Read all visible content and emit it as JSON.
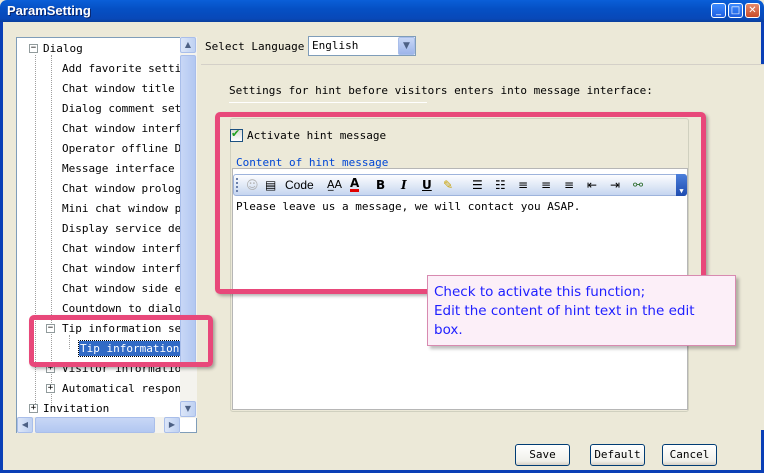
{
  "window": {
    "title": "ParamSetting",
    "controls": {
      "minimize": "_",
      "maximize": "□",
      "close": "✕"
    }
  },
  "tree": {
    "root_dialog": "Dialog",
    "items": [
      "Add favorite setting",
      "Chat window title se",
      "Dialog comment setti",
      "Chat window interfac",
      "Operator offline Dis",
      "Message interface se",
      "Chat window prologue",
      "Mini chat window pro",
      "Display service depa",
      "Chat window interfac",
      "Chat window interfac",
      "Chat window side edg",
      "Countdown to dialog"
    ],
    "tip_info": "Tip information sett",
    "tip_info_child": "Tip information i",
    "visitor_info": "Visitor information",
    "auto_response": "Automatical response",
    "invitation": "Invitation"
  },
  "language": {
    "label": "Select Language",
    "selected": "English"
  },
  "settings_label": "Settings for hint before visitors enters into message interface:",
  "activate": {
    "checked": true,
    "label": "Activate hint message"
  },
  "content_legend": "Content of hint message",
  "toolbar": {
    "smiley_icon": "smiley-icon",
    "code_label": "Code",
    "bold": "B",
    "italic": "I",
    "underline": "U"
  },
  "hint_text": "Please leave us a message, we will contact you ASAP.",
  "callout": {
    "line1": "Check to activate this function;",
    "line2": "Edit the content of hint text in the edit",
    "line3": "box."
  },
  "buttons": {
    "save": "Save",
    "default": "Default",
    "cancel": "Cancel"
  },
  "colors": {
    "accent_pink": "#E8487A",
    "selection_blue": "#316AC5",
    "callout_text": "#2020FF"
  }
}
